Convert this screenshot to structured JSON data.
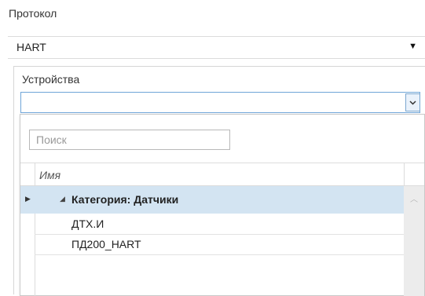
{
  "protocol": {
    "label": "Протокол",
    "value": "HART"
  },
  "devices": {
    "label": "Устройства",
    "value": ""
  },
  "search": {
    "placeholder": "Поиск",
    "value": ""
  },
  "grid": {
    "column_name": "Имя",
    "group_label": "Категория: Датчики",
    "rows": [
      "ДТХ.И",
      "ПД200_HART"
    ]
  },
  "icons": {
    "dropdown": "triangle-down-icon",
    "devices_dropdown": "chevron-down-icon",
    "row_pointer": "row-pointer-icon",
    "group_expander": "expanded-triangle-icon",
    "scroll_up": "chevron-up-icon"
  },
  "colors": {
    "selection": "#d3e4f2",
    "focus_border": "#6fa5d8"
  }
}
